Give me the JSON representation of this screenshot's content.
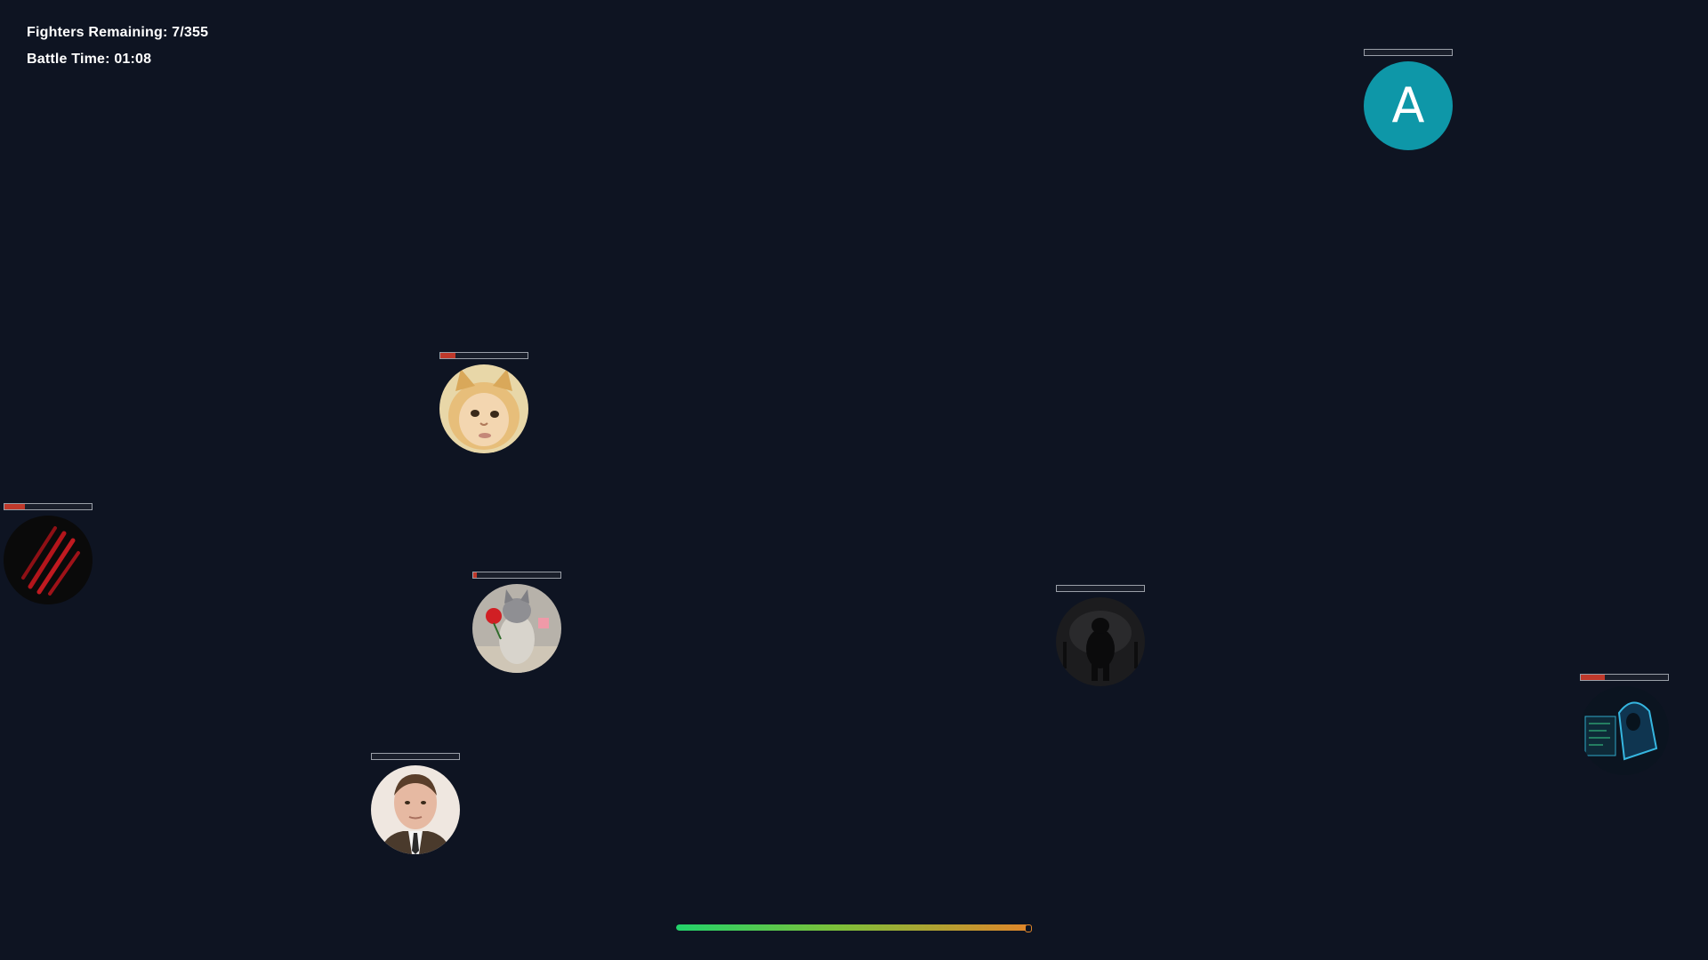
{
  "hud": {
    "fighters_remaining_label": "Fighters Remaining: ",
    "fighters_remaining_value": "7/355",
    "battle_time_label": "Battle Time: ",
    "battle_time_value": "01:08"
  },
  "fighters": [
    {
      "id": "letter-a",
      "avatar_icon": "letter-a-avatar",
      "letter": "A",
      "avatar_color": "#0e97a8",
      "damage_fraction": 0.0
    },
    {
      "id": "cat-kid",
      "avatar_icon": "cat-kid-face-avatar",
      "damage_fraction": 0.17
    },
    {
      "id": "claw",
      "avatar_icon": "red-claw-marks-avatar",
      "damage_fraction": 0.23
    },
    {
      "id": "cat-rose",
      "avatar_icon": "cat-with-rose-avatar",
      "damage_fraction": 0.04
    },
    {
      "id": "shadow-beast",
      "avatar_icon": "dark-werewolf-silhouette-avatar",
      "damage_fraction": 0.0
    },
    {
      "id": "hacker",
      "avatar_icon": "hooded-hacker-avatar",
      "damage_fraction": 0.28
    },
    {
      "id": "office-man",
      "avatar_icon": "balding-man-in-suit-avatar",
      "damage_fraction": 0.0
    }
  ],
  "battle_progress": 0.99,
  "colors": {
    "background": "#0e1422",
    "hp_damage": "#c0392b",
    "progress_start": "#22d36b",
    "progress_end": "#e0862a"
  }
}
